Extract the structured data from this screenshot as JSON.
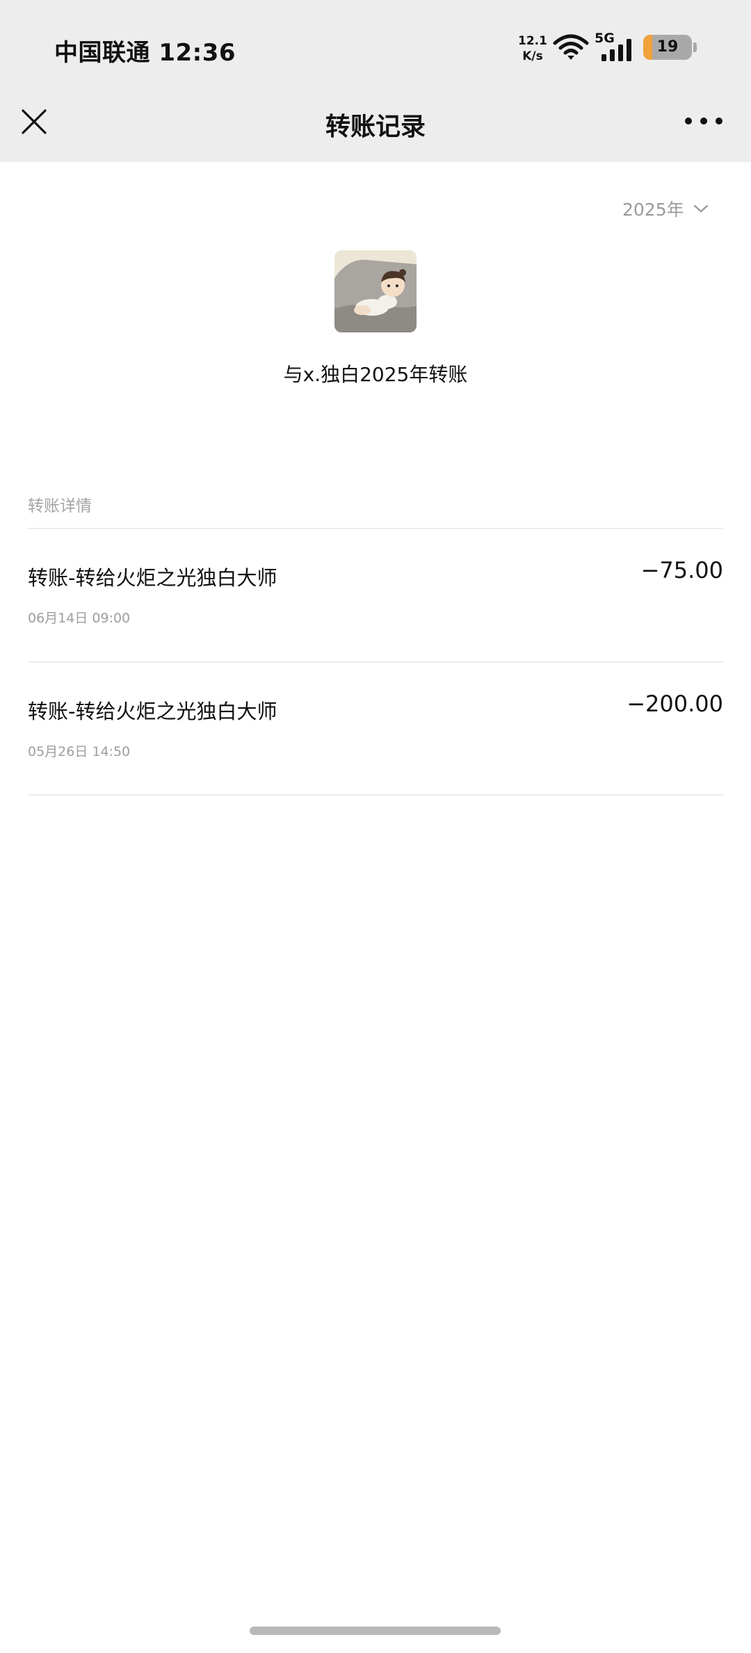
{
  "status_bar": {
    "carrier_time": "中国联通 12:36",
    "net_speed_value": "12.1",
    "net_speed_unit": "K/s",
    "network_type": "5G",
    "battery_level": "19",
    "battery_fraction": 0.19
  },
  "nav": {
    "title": "转账记录",
    "close_icon": "close-icon",
    "more_icon": "more-icon"
  },
  "year_picker": {
    "label": "2025年"
  },
  "summary": {
    "title": "与x.独白2025年转账"
  },
  "section": {
    "label": "转账详情"
  },
  "transactions": [
    {
      "description": "转账-转给火炬之光独白大师",
      "amount": "−75.00",
      "date": "06月14日  09:00"
    },
    {
      "description": "转账-转给火炬之光独白大师",
      "amount": "−200.00",
      "date": "05月26日  14:50"
    }
  ]
}
